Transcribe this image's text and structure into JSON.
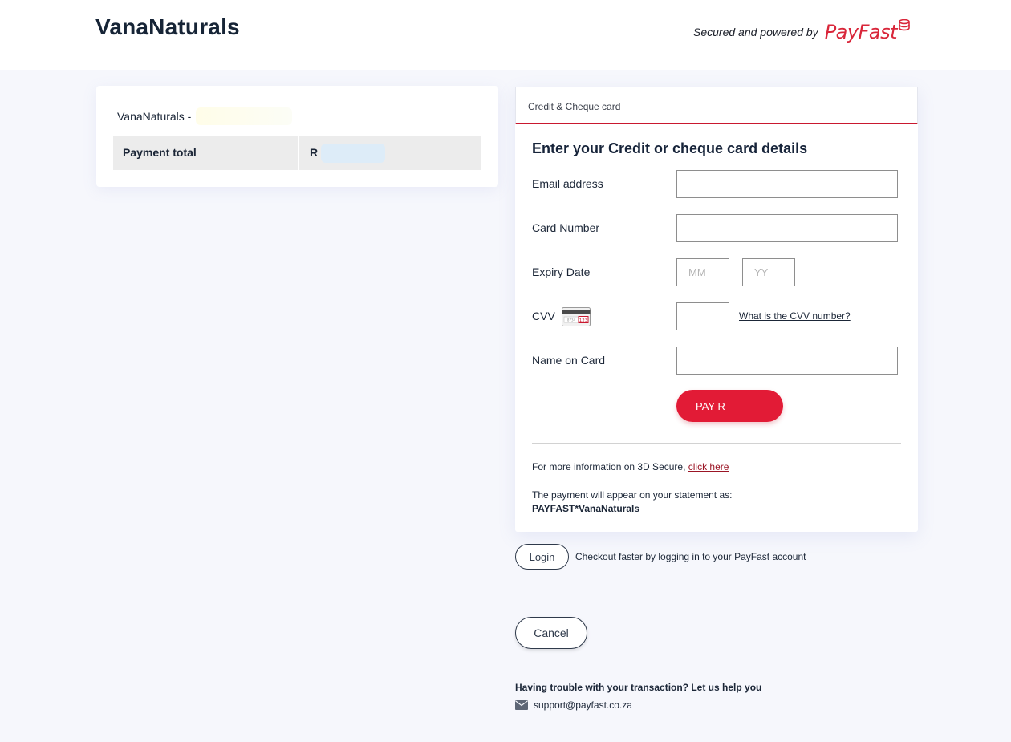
{
  "header": {
    "brand": "VanaNaturals",
    "secured_text": "Secured and powered by",
    "payfast_logo": "PayFast"
  },
  "summary": {
    "merchant": "VanaNaturals -",
    "total_label": "Payment total",
    "total_value": "R"
  },
  "payment": {
    "tab_label": "Credit & Cheque card",
    "heading": "Enter your Credit or cheque card details",
    "labels": {
      "email": "Email address",
      "card_number": "Card Number",
      "expiry": "Expiry Date",
      "cvv": "CVV",
      "name": "Name on Card"
    },
    "placeholders": {
      "mm": "MM",
      "yy": "YY"
    },
    "cvv_link": "What is the CVV number?",
    "pay_button": "PAY R",
    "info_3d": "For more information on 3D Secure,",
    "info_3d_link": "click here",
    "statement_text": "The payment will appear on your statement as:",
    "statement_name": "PAYFAST*VanaNaturals"
  },
  "footer": {
    "login_button": "Login",
    "login_text": "Checkout faster by logging in to your PayFast account",
    "cancel_button": "Cancel",
    "trouble_text": "Having trouble with your transaction? Let us help you",
    "support_email": "support@payfast.co.za"
  },
  "colors": {
    "accent": "#e21b36",
    "background": "#f6f7fc",
    "text": "#1b2637"
  },
  "icons": {
    "cvv_card": "card-cvv-icon",
    "mail": "envelope-icon",
    "logo_coins": "payfast-coins-icon"
  }
}
